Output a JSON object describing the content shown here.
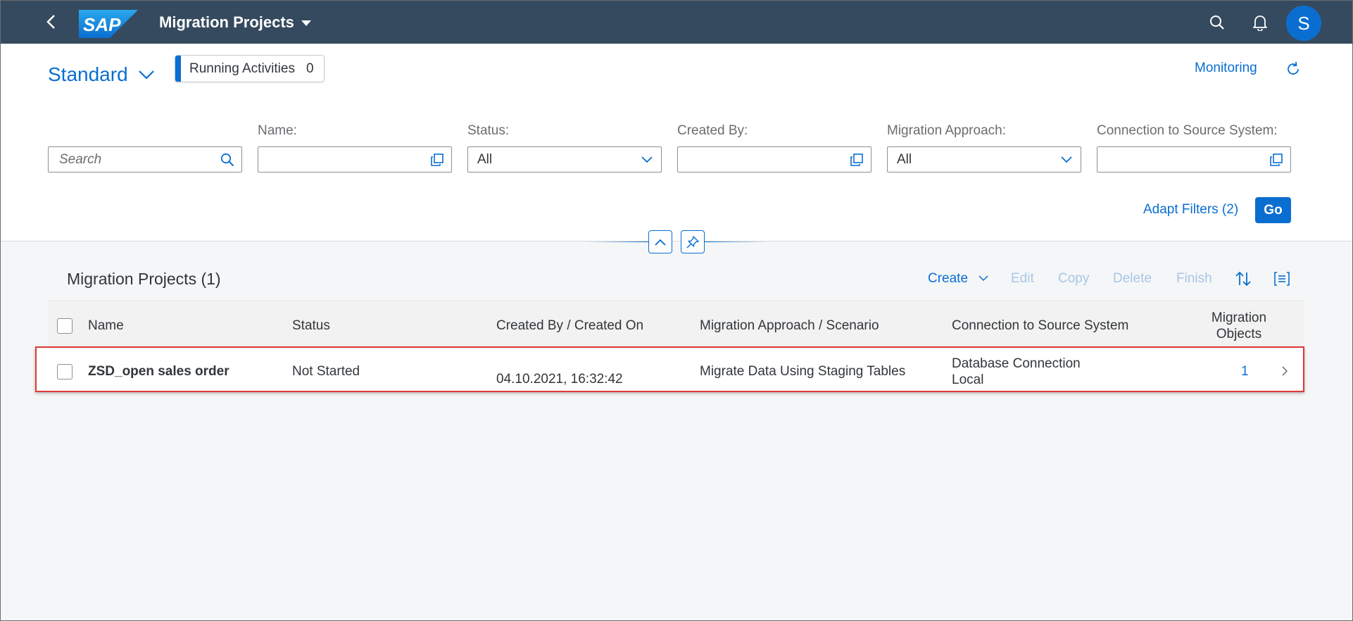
{
  "shell": {
    "logo_text": "SAP",
    "title": "Migration Projects",
    "avatar_initial": "S"
  },
  "header": {
    "variant": "Standard",
    "running_activities": {
      "label": "Running Activities",
      "count": "0"
    },
    "monitoring_label": "Monitoring"
  },
  "filters": {
    "search": {
      "placeholder": "Search",
      "value": ""
    },
    "name": {
      "label": "Name:",
      "value": ""
    },
    "status": {
      "label": "Status:",
      "value": "All"
    },
    "created_by": {
      "label": "Created By:",
      "value": ""
    },
    "migration_approach": {
      "label": "Migration Approach:",
      "value": "All"
    },
    "connection": {
      "label": "Connection to Source System:",
      "value": ""
    },
    "adapt_filters_label": "Adapt Filters (2)",
    "go_label": "Go"
  },
  "table": {
    "title": "Migration Projects (1)",
    "toolbar": {
      "create": "Create",
      "edit": "Edit",
      "copy": "Copy",
      "delete": "Delete",
      "finish": "Finish"
    },
    "columns": {
      "name": "Name",
      "status": "Status",
      "created": "Created By / Created On",
      "approach": "Migration Approach / Scenario",
      "connection": "Connection to Source System",
      "objects_line1": "Migration",
      "objects_line2": "Objects"
    },
    "rows": [
      {
        "name": "ZSD_open sales order",
        "status": "Not Started",
        "created_by": "",
        "created_on": "04.10.2021, 16:32:42",
        "approach": "Migrate Data Using Staging Tables",
        "connection_line1": "Database Connection",
        "connection_line2": "Local",
        "migration_objects": "1"
      }
    ]
  },
  "colors": {
    "shell_bg": "#354a5f",
    "accent": "#0a6ed1",
    "highlight_border": "#e03838"
  }
}
